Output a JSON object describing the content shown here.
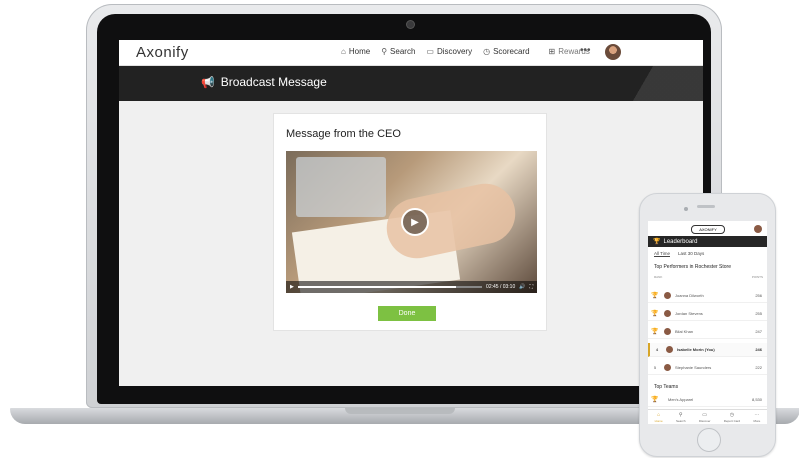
{
  "app": {
    "logo": "Axonify"
  },
  "nav": {
    "items": [
      {
        "icon": "home-icon",
        "glyph": "⌂",
        "label": "Home"
      },
      {
        "icon": "search-icon",
        "glyph": "⚲",
        "label": "Search"
      },
      {
        "icon": "discovery-icon",
        "glyph": "▭",
        "label": "Discovery"
      },
      {
        "icon": "scorecard-icon",
        "glyph": "◷",
        "label": "Scorecard"
      },
      {
        "icon": "rewards-icon",
        "glyph": "⊞",
        "label": "Rewards"
      }
    ],
    "more": "•••"
  },
  "banner": {
    "icon": "megaphone-icon",
    "glyph": "📢",
    "title": "Broadcast Message"
  },
  "message": {
    "title": "Message from the CEO",
    "video": {
      "time": "02:45 / 03:10",
      "progress_fraction": 0.86
    },
    "done_label": "Done"
  },
  "phone": {
    "logo": "AXONIFY",
    "header_title": "Leaderboard",
    "tabs": [
      "All Time",
      "Last 30 Days"
    ],
    "subtitle": "Top Performers in Rochester Store",
    "columns": {
      "rank": "RANK",
      "points": "POINTS"
    },
    "performers": [
      {
        "rank": "🏆",
        "name": "Joanna Dilworth",
        "points": "256",
        "style": "gold"
      },
      {
        "rank": "🏆",
        "name": "Jordan Stevens",
        "points": "255",
        "style": "silver"
      },
      {
        "rank": "🏆",
        "name": "Bilal Khan",
        "points": "247",
        "style": "gold"
      },
      {
        "rank": "4",
        "name": "Isabelle Morin (You)",
        "points": "246",
        "style": "highlight"
      },
      {
        "rank": "5",
        "name": "Stephanie Saunders",
        "points": "222",
        "style": "plain"
      }
    ],
    "teams_title": "Top Teams",
    "teams": [
      {
        "rank": "🏆",
        "name": "Men's Apparel",
        "points": "8,530"
      }
    ],
    "bottom_nav": [
      {
        "glyph": "⌂",
        "label": "Home"
      },
      {
        "glyph": "⚲",
        "label": "Search"
      },
      {
        "glyph": "▭",
        "label": "Discover"
      },
      {
        "glyph": "◷",
        "label": "Report Card"
      },
      {
        "glyph": "⋯",
        "label": "More"
      }
    ]
  }
}
